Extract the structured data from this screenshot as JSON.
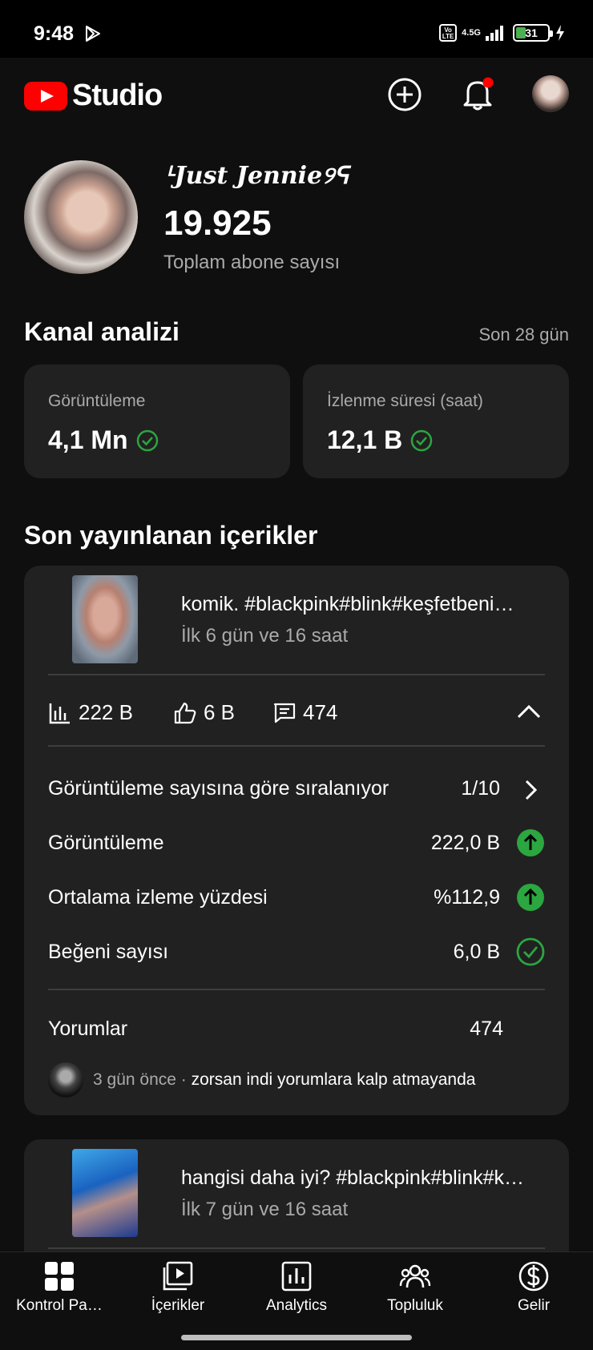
{
  "status_bar": {
    "time": "9:48",
    "network": "4.5G",
    "volte": "Vo LTE",
    "battery": "31"
  },
  "header": {
    "app_name": "Studio",
    "icons": [
      "create-icon",
      "notifications-icon",
      "account-avatar"
    ]
  },
  "channel": {
    "name": "ᒻJust Jennie୨ᕋ",
    "subscribers": "19.925",
    "subscribers_label": "Toplam abone sayısı"
  },
  "analytics": {
    "title": "Kanal analizi",
    "period": "Son 28 gün",
    "metrics": [
      {
        "label": "Görüntüleme",
        "value": "4,1 Mn"
      },
      {
        "label": "İzlenme süresi (saat)",
        "value": "12,1 B"
      }
    ]
  },
  "recent": {
    "title": "Son yayınlanan içerikler",
    "items": [
      {
        "title": "komik. #blackpink#blink#keşfetbeni…",
        "subtitle": "İlk 6 gün ve 16 saat",
        "views": "222 B",
        "likes": "6 B",
        "comments": "474",
        "rows": [
          {
            "label": "Görüntüleme sayısına göre sıralanıyor",
            "value": "1/10",
            "icon": "chevron-right-icon"
          },
          {
            "label": "Görüntüleme",
            "value": "222,0 B",
            "icon": "arrow-up-icon"
          },
          {
            "label": "Ortalama izleme yüzdesi",
            "value": "%112,9",
            "icon": "arrow-up-icon"
          },
          {
            "label": "Beğeni sayısı",
            "value": "6,0 B",
            "icon": "check-icon"
          }
        ],
        "comments_label": "Yorumlar",
        "comments_count": "474",
        "latest_comment": {
          "time": "3 gün önce",
          "separator": " · ",
          "text": "zorsan indi yorumlara kalp atmayanda"
        }
      },
      {
        "title": "hangisi daha iyi? #blackpink#blink#k…",
        "subtitle": "İlk 7 gün ve 16 saat"
      }
    ]
  },
  "colors": {
    "accent_red": "#ff0000",
    "success_green": "#2ba640",
    "card_bg": "#212121",
    "bg": "#0f0f0f"
  },
  "bottom_nav": [
    {
      "label": "Kontrol Pa…",
      "icon": "dashboard-icon"
    },
    {
      "label": "İçerikler",
      "icon": "content-icon"
    },
    {
      "label": "Analytics",
      "icon": "analytics-icon"
    },
    {
      "label": "Topluluk",
      "icon": "community-icon"
    },
    {
      "label": "Gelir",
      "icon": "earn-icon"
    }
  ]
}
